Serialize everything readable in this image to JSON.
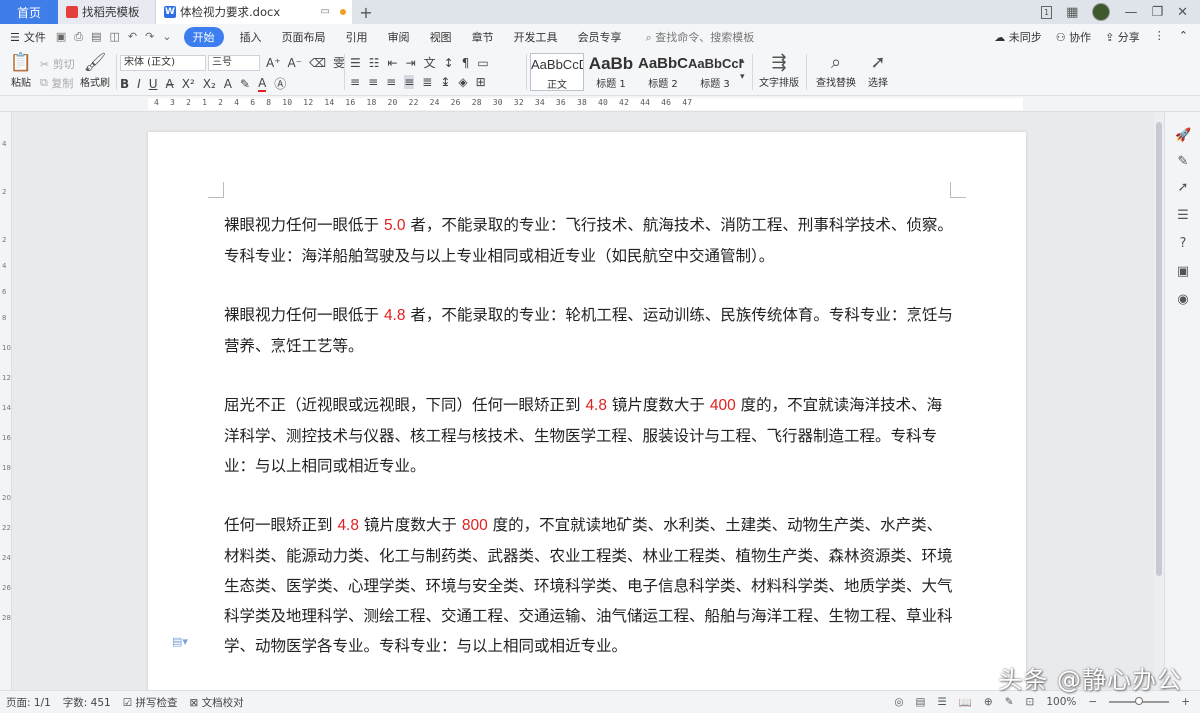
{
  "tabs": {
    "home": "首页",
    "template_tab": "找稻壳模板",
    "doc_tab": "体检视力要求.docx",
    "new_tab": "+"
  },
  "window": {
    "badge": "1"
  },
  "menu": {
    "file": "文件",
    "start": "开始",
    "items": [
      "插入",
      "页面布局",
      "引用",
      "审阅",
      "视图",
      "章节",
      "开发工具",
      "会员专享"
    ],
    "search": "查找命令、搜索模板",
    "sync": "未同步",
    "collab": "协作",
    "share": "分享"
  },
  "ribbon": {
    "paste": "粘贴",
    "cut": "剪切",
    "copy": "复制",
    "format_painter": "格式刷",
    "font_name": "宋体 (正文)",
    "font_size": "三号",
    "styles": [
      {
        "sample": "AaBbCcDd",
        "label": "正文"
      },
      {
        "sample": "AaBb",
        "label": "标题 1"
      },
      {
        "sample": "AaBbC",
        "label": "标题 2"
      },
      {
        "sample": "AaBbCcI",
        "label": "标题 3"
      }
    ],
    "text_layout": "文字排版",
    "find_replace": "查找替换",
    "select": "选择"
  },
  "ruler": {
    "numbers": "4 3 2 1 2 4 6 8 10 12 14 16 18 20 22 24 26 28 30 32 34 36 38 40 42 44 46 47",
    "vertical": [
      "4",
      "2",
      "2",
      "4",
      "6",
      "8",
      "10",
      "12",
      "14",
      "16",
      "18",
      "20",
      "22",
      "24",
      "26",
      "28"
    ]
  },
  "document": {
    "paragraphs": [
      {
        "a": "裸眼视力任何一眼低于 ",
        "n1": "5.0",
        "b": " 者，不能录取的专业：飞行技术、航海技术、消防工程、刑事科学技术、侦察。专科专业：海洋船舶驾驶及与以上专业相同或相近专业（如民航空中交通管制）。"
      },
      {
        "a": "裸眼视力任何一眼低于 ",
        "n1": "4.8",
        "b": " 者，不能录取的专业：轮机工程、运动训练、民族传统体育。专科专业：烹饪与营养、烹饪工艺等。"
      },
      {
        "a": "屈光不正（近视眼或远视眼，下同）任何一眼矫正到 ",
        "n1": "4.8",
        "b": " 镜片度数大于 ",
        "n2": "400",
        "c": " 度的，不宜就读海洋技术、海洋科学、测控技术与仪器、核工程与核技术、生物医学工程、服装设计与工程、飞行器制造工程。专科专业：与以上相同或相近专业。"
      },
      {
        "a": "任何一眼矫正到 ",
        "n1": "4.8",
        "b": " 镜片度数大于 ",
        "n2": "800",
        "c": " 度的，不宜就读地矿类、水利类、土建类、动物生产类、水产类、材料类、能源动力类、化工与制药类、武器类、农业工程类、林业工程类、植物生产类、森林资源类、环境生态类、医学类、心理学类、环境与安全类、环境科学类、电子信息科学类、材料科学类、地质学类、大气科学类及地理科学、测绘工程、交通工程、交通运输、油气储运工程、船舶与海洋工程、生物工程、草业科学、动物医学各专业。专科专业：与以上相同或相近专业。"
      }
    ]
  },
  "status": {
    "page": "页面: 1/1",
    "words": "字数: 451",
    "spell": "拼写检查",
    "proof": "文档校对",
    "zoom": "100%"
  },
  "watermark": "头条 @静心办公",
  "colors": {
    "accent": "#3f7ee8",
    "number_red": "#e02020"
  }
}
